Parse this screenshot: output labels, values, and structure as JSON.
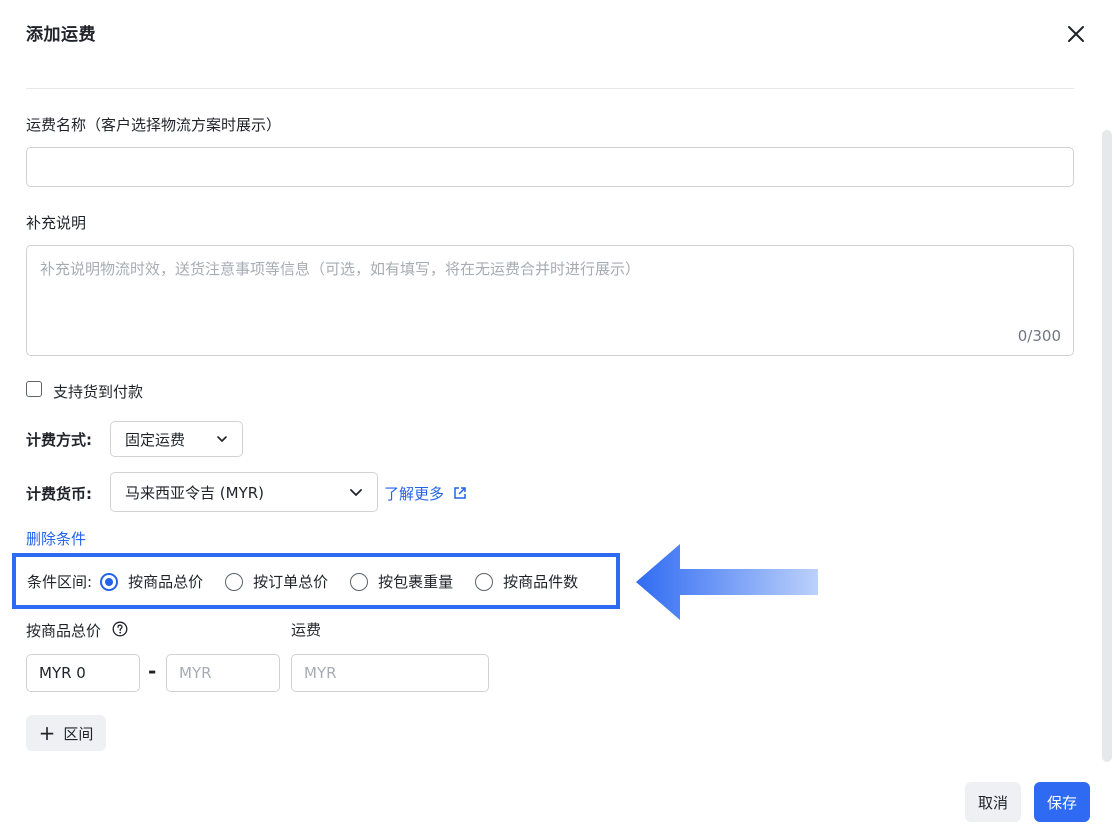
{
  "dialog": {
    "title": "添加运费",
    "close_icon": "close-icon"
  },
  "form": {
    "shipping_name": {
      "label": "运费名称（客户选择物流方案时展示）",
      "value": ""
    },
    "description": {
      "label": "补充说明",
      "placeholder": "补充说明物流时效，送货注意事项等信息（可选，如有填写，将在无运费合并时进行展示）",
      "counter": "0/300"
    },
    "cod": {
      "label": "支持货到付款",
      "checked": false
    },
    "billing_method": {
      "label": "计费方式:",
      "value": "固定运费"
    },
    "currency": {
      "label": "计费货币:",
      "value": "马来西亚令吉 (MYR)",
      "learn_more": "了解更多"
    },
    "delete_condition": "删除条件",
    "condition_range": {
      "label": "条件区间:",
      "options": [
        {
          "label": "按商品总价",
          "selected": true
        },
        {
          "label": "按订单总价",
          "selected": false
        },
        {
          "label": "按包裹重量",
          "selected": false
        },
        {
          "label": "按商品件数",
          "selected": false
        }
      ]
    },
    "range": {
      "label": "按商品总价",
      "fee_label": "运费",
      "min_value": "MYR 0",
      "max_placeholder": "MYR",
      "fee_placeholder": "MYR",
      "separator": "-"
    },
    "add_range_button": "区间"
  },
  "footer": {
    "cancel": "取消",
    "save": "保存"
  },
  "colors": {
    "primary": "#2f6bf2",
    "highlight_border": "#2f6bf2",
    "link": "#2463eb"
  }
}
